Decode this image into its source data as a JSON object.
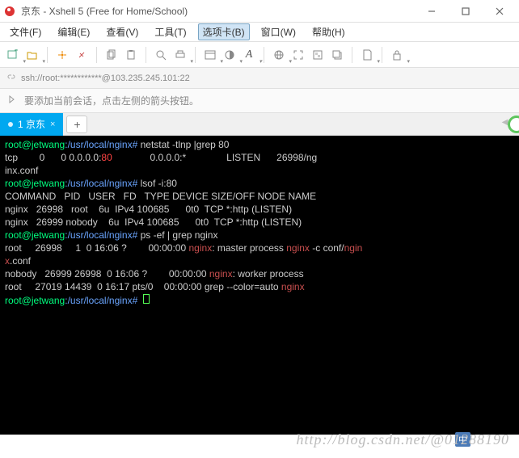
{
  "title": "京东 - Xshell 5 (Free for Home/School)",
  "menu": [
    "文件(F)",
    "编辑(E)",
    "查看(V)",
    "工具(T)",
    "选项卡(B)",
    "窗口(W)",
    "帮助(H)"
  ],
  "menu_active_index": 4,
  "address": "ssh://root:************@103.235.245.101:22",
  "tip_text": "要添加当前会话，点击左侧的箭头按钮。",
  "tab": {
    "label": "1 京东"
  },
  "watermark": "http://blog.csdn.net/@01288190",
  "ime": "中",
  "term": {
    "prompt_user": "root@jetwang",
    "prompt_path": ":/usr/local/nginx#",
    "cmd1": " netstat -tlnp |grep 80",
    "l_tcp": "tcp        0      0 0.0.0.0:",
    "port80": "80",
    "l_tcp2": "              0.0.0.0:*               LISTEN      26998/ng",
    "inxconf": "inx.conf   ",
    "cmd2": " lsof -i:80",
    "lsof_hdr": "COMMAND   PID   USER   FD   TYPE DEVICE SIZE/OFF NODE NAME",
    "lsof1": "nginx   26998   root    6u  IPv4 100685      0t0  TCP *:http (LISTEN)",
    "lsof2": "nginx   26999 nobody    6u  IPv4 100685      0t0  TCP *:http (LISTEN)",
    "cmd3": " ps -ef | grep nginx",
    "ps1a": "root     26998     1  0 16:06 ?        00:00:00 ",
    "ps1b": ": master process ",
    "ps1c": " -c conf/",
    "ps2": ".conf",
    "ps3a": "nobody   26999 26998  0 16:06 ?        00:00:00 ",
    "ps3b": ": worker process",
    "ps4a": "root     27019 14439  0 16:17 pts/0    00:00:00 grep --color=auto ",
    "nginx": "nginx",
    "ngin": "ngin",
    "x": "x"
  }
}
